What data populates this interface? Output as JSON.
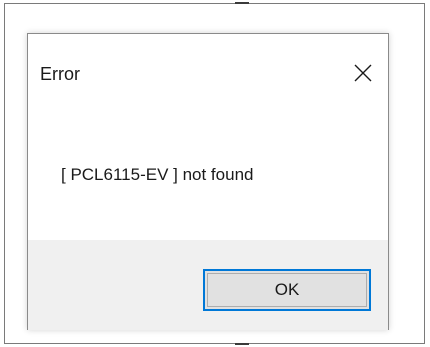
{
  "dialog": {
    "title": "Error",
    "message": "[ PCL6115-EV ] not found",
    "close_icon": "close-icon",
    "ok_label": "OK",
    "accent_color": "#0078d7",
    "footer_color": "#f0f0f0"
  }
}
